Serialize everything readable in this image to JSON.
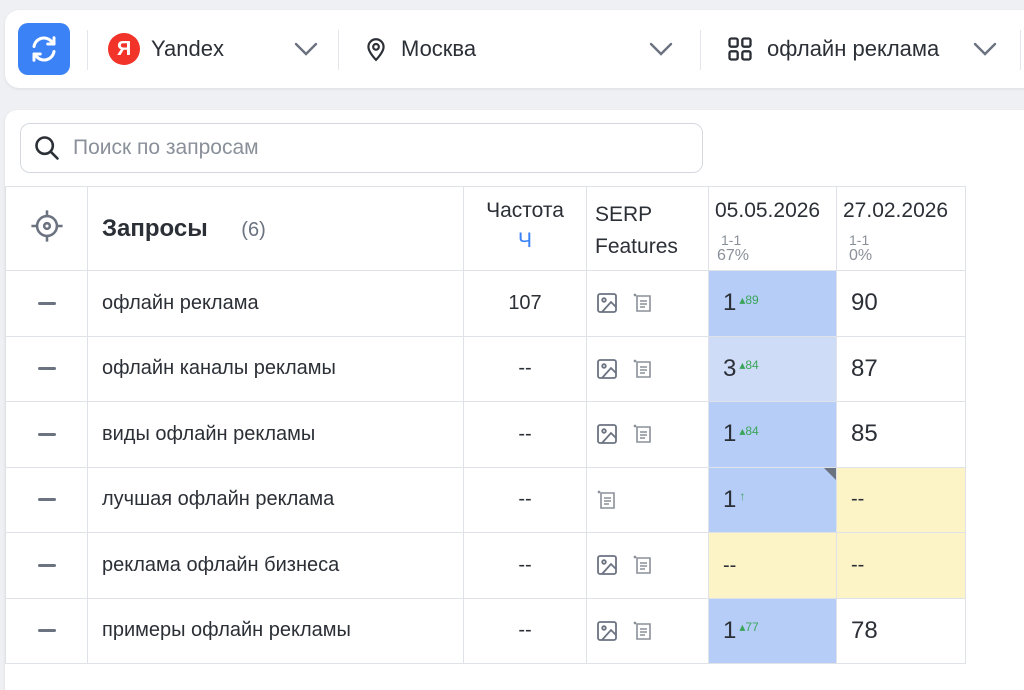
{
  "toolbar": {
    "engine": "Yandex",
    "engine_logo_letter": "Я",
    "region": "Москва",
    "project": "офлайн реклама"
  },
  "search": {
    "placeholder": "Поиск по запросам"
  },
  "table": {
    "header": {
      "queries_label": "Запросы",
      "queries_count": "(6)",
      "freq_label": "Частота",
      "freq_unit": "Ч",
      "serp_label": "SERP Features",
      "dates": [
        {
          "date": "05.05.2026",
          "range": "1-1",
          "percent": "67%"
        },
        {
          "date": "27.02.2026",
          "range": "1-1",
          "percent": "0%"
        }
      ]
    },
    "rows": [
      {
        "query": "офлайн реклама",
        "freq": "107",
        "pos1": "1",
        "delta1": "▴89",
        "pos2": "90"
      },
      {
        "query": "офлайн каналы рекламы",
        "freq": "--",
        "pos1": "3",
        "delta1": "▴84",
        "pos2": "87"
      },
      {
        "query": "виды офлайн рекламы",
        "freq": "--",
        "pos1": "1",
        "delta1": "▴84",
        "pos2": "85"
      },
      {
        "query": "лучшая офлайн реклама",
        "freq": "--",
        "pos1": "1",
        "delta1": "↑",
        "pos2": "--"
      },
      {
        "query": "реклама офлайн бизнеса",
        "freq": "--",
        "pos1": "--",
        "delta1": "",
        "pos2": "--"
      },
      {
        "query": "примеры офлайн рекламы",
        "freq": "--",
        "pos1": "1",
        "delta1": "▴77",
        "pos2": "78"
      }
    ]
  },
  "colors": {
    "accent": "#3b82f6",
    "pos_top": "#b6cdf7",
    "pos_mid": "#cfdcf8",
    "missing": "#fcf3c6",
    "delta_up": "#3aa55a"
  }
}
